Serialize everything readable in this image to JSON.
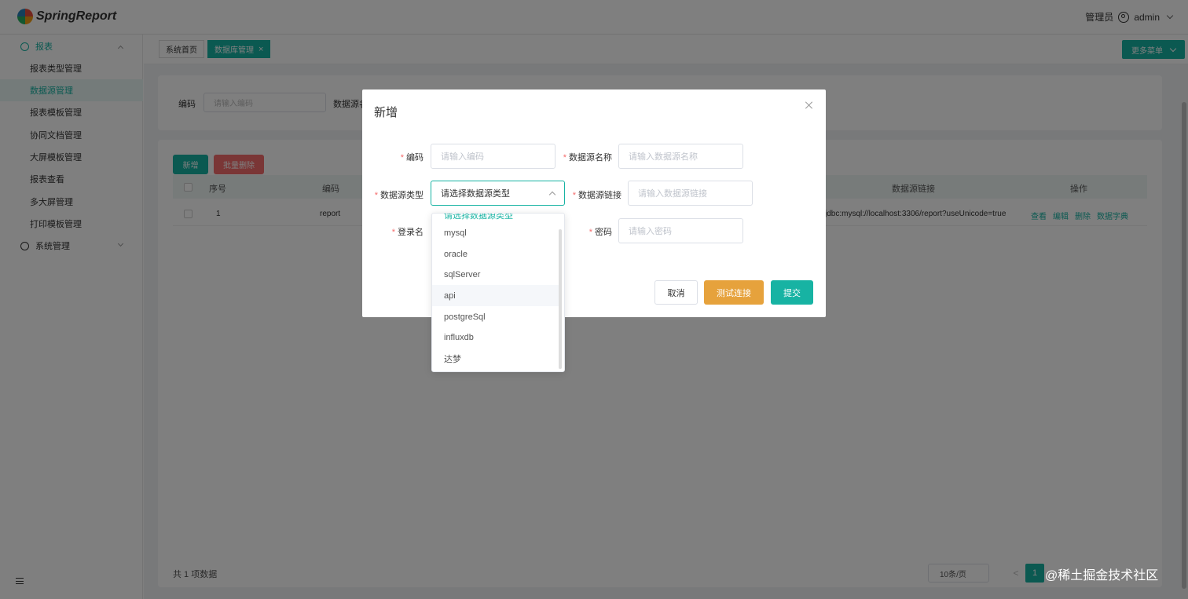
{
  "app": {
    "brand": "SpringReport",
    "user_role": "管理员",
    "username": "admin"
  },
  "sidebar": {
    "groups": [
      {
        "label": "报表"
      },
      {
        "label": "系统管理"
      }
    ],
    "items": [
      {
        "label": "报表类型管理"
      },
      {
        "label": "数据源管理",
        "active": true
      },
      {
        "label": "报表模板管理"
      },
      {
        "label": "协同文档管理"
      },
      {
        "label": "大屏模板管理"
      },
      {
        "label": "报表查看"
      },
      {
        "label": "多大屏管理"
      },
      {
        "label": "打印模板管理"
      }
    ]
  },
  "tabs": [
    {
      "label": "系统首页"
    },
    {
      "label": "数据库管理",
      "active": true,
      "close": "×"
    }
  ],
  "more_menu": "更多菜单",
  "search": {
    "code_label": "编码",
    "code_placeholder": "请输入编码",
    "name_label": "数据源名"
  },
  "toolbar": {
    "add": "新增",
    "batch_delete": "批量删除"
  },
  "table": {
    "headers": [
      "序号",
      "编码",
      "数据源链接",
      "操作"
    ],
    "rows": [
      {
        "index": "1",
        "code": "report",
        "link": "jdbc:mysql://localhost:3306/report?useUnicode=true..."
      }
    ],
    "actions": [
      "查看",
      "编辑",
      "删除",
      "数据字典"
    ]
  },
  "pagination": {
    "total": "共 1 项数据",
    "page_size": "10条/页",
    "prev": "<",
    "current": "1"
  },
  "dialog": {
    "title": "新增",
    "fields": {
      "code_label": "编码",
      "code_placeholder": "请输入编码",
      "name_label": "数据源名称",
      "name_placeholder": "请输入数据源名称",
      "type_label": "数据源类型",
      "type_placeholder": "请选择数据源类型",
      "link_label": "数据源链接",
      "link_placeholder": "请输入数据源链接",
      "user_label": "登录名",
      "password_label": "密码",
      "password_placeholder": "请输入密码",
      "required_mark": "*"
    },
    "buttons": {
      "cancel": "取消",
      "test": "测试连接",
      "submit": "提交"
    }
  },
  "dropdown": {
    "options": [
      "mysql",
      "oracle",
      "sqlServer",
      "api",
      "postgreSql",
      "influxdb",
      "达梦"
    ],
    "hovered": "api"
  },
  "watermark": "@稀土掘金技术社区",
  "colors": {
    "accent": "#17b3a3",
    "danger": "#f56c6c",
    "warning": "#e6a23c"
  }
}
